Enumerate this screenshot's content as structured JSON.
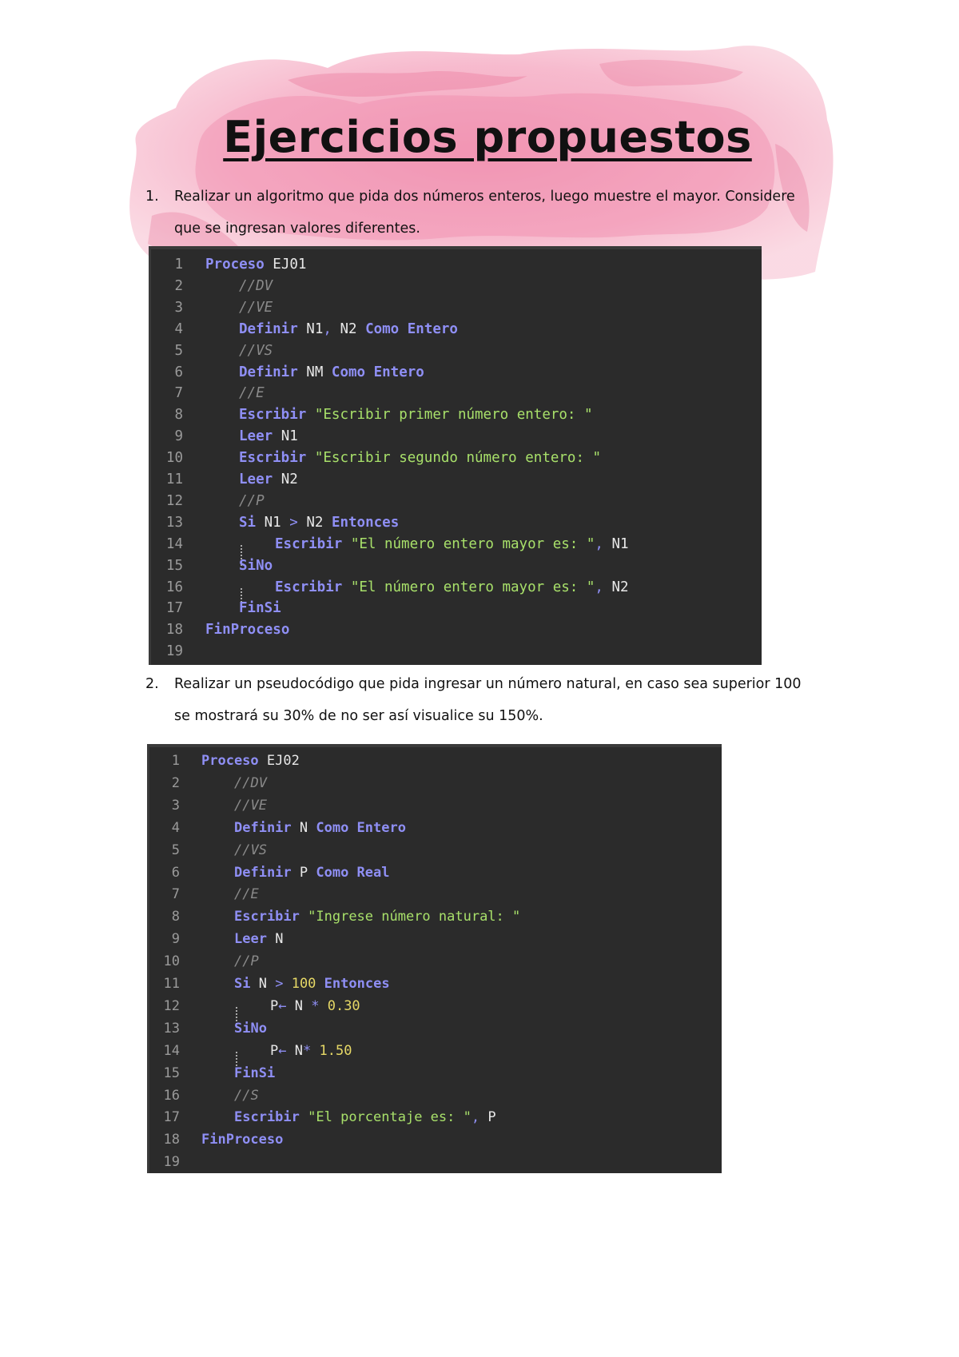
{
  "title": "Ejercicios propuestos",
  "exercises": [
    {
      "number": "1.",
      "lines": [
        "Realizar un algoritmo que pida dos números enteros, luego muestre el mayor. Considere",
        "que se ingresan valores diferentes."
      ]
    },
    {
      "number": "2.",
      "lines": [
        "Realizar un pseudocódigo que pida ingresar un número natural, en caso sea superior 100",
        "se mostrará su 30% de no ser así visualice su 150%."
      ]
    }
  ],
  "code_blocks": [
    {
      "lines": [
        {
          "n": "1",
          "indent": 0,
          "tokens": [
            [
              "kw",
              "Proceso"
            ],
            [
              "tx",
              " EJ01"
            ]
          ]
        },
        {
          "n": "2",
          "indent": 1,
          "tokens": [
            [
              "cm",
              "//DV"
            ]
          ]
        },
        {
          "n": "3",
          "indent": 1,
          "tokens": [
            [
              "cm",
              "//VE"
            ]
          ]
        },
        {
          "n": "4",
          "indent": 1,
          "tokens": [
            [
              "kw",
              "Definir"
            ],
            [
              "tx",
              " N1"
            ],
            [
              "op",
              ","
            ],
            [
              "tx",
              " N2 "
            ],
            [
              "kw",
              "Como Entero"
            ]
          ]
        },
        {
          "n": "5",
          "indent": 1,
          "tokens": [
            [
              "cm",
              "//VS"
            ]
          ]
        },
        {
          "n": "6",
          "indent": 1,
          "tokens": [
            [
              "kw",
              "Definir"
            ],
            [
              "tx",
              " NM "
            ],
            [
              "kw",
              "Como Entero"
            ]
          ]
        },
        {
          "n": "7",
          "indent": 1,
          "tokens": [
            [
              "cm",
              "//E"
            ]
          ]
        },
        {
          "n": "8",
          "indent": 1,
          "tokens": [
            [
              "kw",
              "Escribir"
            ],
            [
              "tx",
              " "
            ],
            [
              "st",
              "\"Escribir primer número entero: \""
            ]
          ]
        },
        {
          "n": "9",
          "indent": 1,
          "tokens": [
            [
              "kw",
              "Leer"
            ],
            [
              "tx",
              " N1"
            ]
          ]
        },
        {
          "n": "10",
          "indent": 1,
          "tokens": [
            [
              "kw",
              "Escribir"
            ],
            [
              "tx",
              " "
            ],
            [
              "st",
              "\"Escribir segundo número entero: \""
            ]
          ]
        },
        {
          "n": "11",
          "indent": 1,
          "tokens": [
            [
              "kw",
              "Leer"
            ],
            [
              "tx",
              " N2"
            ]
          ]
        },
        {
          "n": "12",
          "indent": 1,
          "tokens": [
            [
              "cm",
              "//P"
            ]
          ]
        },
        {
          "n": "13",
          "indent": 1,
          "tokens": [
            [
              "kw",
              "Si"
            ],
            [
              "tx",
              " N1 "
            ],
            [
              "op",
              ">"
            ],
            [
              "tx",
              " N2 "
            ],
            [
              "kw",
              "Entonces"
            ]
          ]
        },
        {
          "n": "14",
          "indent": 1,
          "guide": true,
          "tokens": [
            [
              "kw",
              "Escribir"
            ],
            [
              "tx",
              " "
            ],
            [
              "st",
              "\"El número entero mayor es: \""
            ],
            [
              "op",
              ","
            ],
            [
              "tx",
              " N1"
            ]
          ]
        },
        {
          "n": "15",
          "indent": 1,
          "tokens": [
            [
              "kw",
              "SiNo"
            ]
          ]
        },
        {
          "n": "16",
          "indent": 1,
          "guide": true,
          "tokens": [
            [
              "kw",
              "Escribir"
            ],
            [
              "tx",
              " "
            ],
            [
              "st",
              "\"El número entero mayor es: \""
            ],
            [
              "op",
              ","
            ],
            [
              "tx",
              " N2"
            ]
          ]
        },
        {
          "n": "17",
          "indent": 1,
          "tokens": [
            [
              "kw",
              "FinSi"
            ]
          ]
        },
        {
          "n": "18",
          "indent": 0,
          "tokens": [
            [
              "kw",
              "FinProceso"
            ]
          ]
        },
        {
          "n": "19",
          "indent": 0,
          "tokens": []
        }
      ]
    },
    {
      "lines": [
        {
          "n": "1",
          "indent": 0,
          "tokens": [
            [
              "kw",
              "Proceso"
            ],
            [
              "tx",
              " EJ02"
            ]
          ]
        },
        {
          "n": "2",
          "indent": 1,
          "tokens": [
            [
              "cm",
              "//DV"
            ]
          ]
        },
        {
          "n": "3",
          "indent": 1,
          "tokens": [
            [
              "cm",
              "//VE"
            ]
          ]
        },
        {
          "n": "4",
          "indent": 1,
          "tokens": [
            [
              "kw",
              "Definir"
            ],
            [
              "tx",
              " N "
            ],
            [
              "kw",
              "Como Entero"
            ]
          ]
        },
        {
          "n": "5",
          "indent": 1,
          "tokens": [
            [
              "cm",
              "//VS"
            ]
          ]
        },
        {
          "n": "6",
          "indent": 1,
          "tokens": [
            [
              "kw",
              "Definir"
            ],
            [
              "tx",
              " P "
            ],
            [
              "kw",
              "Como Real"
            ]
          ]
        },
        {
          "n": "7",
          "indent": 1,
          "tokens": [
            [
              "cm",
              "//E"
            ]
          ]
        },
        {
          "n": "8",
          "indent": 1,
          "tokens": [
            [
              "kw",
              "Escribir"
            ],
            [
              "tx",
              " "
            ],
            [
              "st",
              "\"Ingrese número natural: \""
            ]
          ]
        },
        {
          "n": "9",
          "indent": 1,
          "tokens": [
            [
              "kw",
              "Leer"
            ],
            [
              "tx",
              " N"
            ]
          ]
        },
        {
          "n": "10",
          "indent": 1,
          "tokens": [
            [
              "cm",
              "//P"
            ]
          ]
        },
        {
          "n": "11",
          "indent": 1,
          "tokens": [
            [
              "kw",
              "Si"
            ],
            [
              "tx",
              " N "
            ],
            [
              "op",
              ">"
            ],
            [
              "tx",
              " "
            ],
            [
              "nm",
              "100"
            ],
            [
              "tx",
              " "
            ],
            [
              "kw",
              "Entonces"
            ]
          ]
        },
        {
          "n": "12",
          "indent": 1,
          "guide": true,
          "tokens": [
            [
              "tx",
              "P"
            ],
            [
              "op",
              "←"
            ],
            [
              "tx",
              " N "
            ],
            [
              "op",
              "*"
            ],
            [
              "tx",
              " "
            ],
            [
              "nm",
              "0.30"
            ]
          ]
        },
        {
          "n": "13",
          "indent": 1,
          "tokens": [
            [
              "kw",
              "SiNo"
            ]
          ]
        },
        {
          "n": "14",
          "indent": 1,
          "guide": true,
          "tokens": [
            [
              "tx",
              "P"
            ],
            [
              "op",
              "←"
            ],
            [
              "tx",
              " N"
            ],
            [
              "op",
              "*"
            ],
            [
              "tx",
              " "
            ],
            [
              "nm",
              "1.50"
            ]
          ]
        },
        {
          "n": "15",
          "indent": 1,
          "tokens": [
            [
              "kw",
              "FinSi"
            ]
          ]
        },
        {
          "n": "16",
          "indent": 1,
          "tokens": [
            [
              "cm",
              "//S"
            ]
          ]
        },
        {
          "n": "17",
          "indent": 1,
          "tokens": [
            [
              "kw",
              "Escribir"
            ],
            [
              "tx",
              " "
            ],
            [
              "st",
              "\"El porcentaje es: \""
            ],
            [
              "op",
              ","
            ],
            [
              "tx",
              " P"
            ]
          ]
        },
        {
          "n": "18",
          "indent": 0,
          "tokens": [
            [
              "kw",
              "FinProceso"
            ]
          ]
        },
        {
          "n": "19",
          "indent": 0,
          "tokens": []
        }
      ]
    }
  ],
  "colors": {
    "code_background": "#2b2b2b",
    "keyword": "#8f8ff5",
    "string": "#a8e06a",
    "number": "#e6d866",
    "comment": "#8a8a8a",
    "line_number": "#9a9a9a",
    "watercolor": "#f08fae"
  }
}
